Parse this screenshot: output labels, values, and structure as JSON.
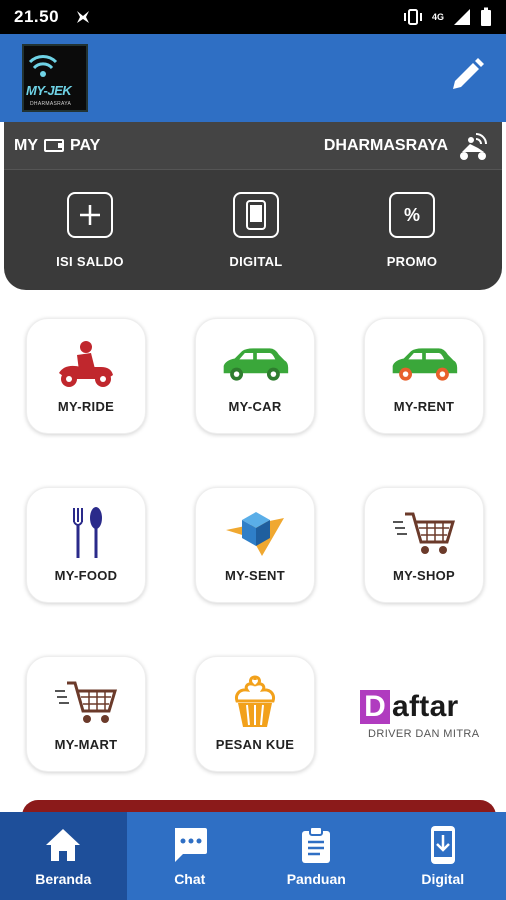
{
  "status_bar": {
    "time": "21.50",
    "network": "4G",
    "icons": [
      "app-notification-icon",
      "vibrate-icon",
      "signal-icon",
      "battery-icon"
    ]
  },
  "app_bar": {
    "logo_text": "MY-JEK",
    "logo_subtext": "DHARMASRAYA",
    "edit_icon": "pencil-icon"
  },
  "pay_card": {
    "pay_prefix": "MY",
    "pay_suffix": "PAY",
    "region": "DHARMASRAYA",
    "actions": [
      {
        "label": "ISI SALDO",
        "icon": "plus-icon",
        "glyph": "+"
      },
      {
        "label": "DIGITAL",
        "icon": "phone-icon",
        "glyph": ""
      },
      {
        "label": "PROMO",
        "icon": "percent-icon",
        "glyph": "%"
      }
    ]
  },
  "services": [
    {
      "label": "MY-RIDE",
      "icon": "motorbike-icon"
    },
    {
      "label": "MY-CAR",
      "icon": "car-icon"
    },
    {
      "label": "MY-RENT",
      "icon": "rent-car-icon"
    },
    {
      "label": "MY-FOOD",
      "icon": "cutlery-icon"
    },
    {
      "label": "MY-SENT",
      "icon": "package-icon"
    },
    {
      "label": "MY-SHOP",
      "icon": "cart-icon"
    },
    {
      "label": "MY-MART",
      "icon": "cart-icon"
    },
    {
      "label": "PESAN KUE",
      "icon": "cupcake-icon"
    }
  ],
  "daftar": {
    "d": "D",
    "rest": "aftar",
    "subtitle": "DRIVER DAN MITRA"
  },
  "bottom_nav": [
    {
      "label": "Beranda",
      "icon": "home-icon",
      "active": true
    },
    {
      "label": "Chat",
      "icon": "chat-icon",
      "active": false
    },
    {
      "label": "Panduan",
      "icon": "clipboard-icon",
      "active": false
    },
    {
      "label": "Digital",
      "icon": "phone-download-icon",
      "active": false
    }
  ],
  "colors": {
    "primary": "#2f6fc4",
    "nav_active": "#1e4f9a",
    "card_dark": "#3a3a3a",
    "ride_red": "#c0272d",
    "car_green": "#3aa73a",
    "daftar_purple": "#b03bbf"
  }
}
